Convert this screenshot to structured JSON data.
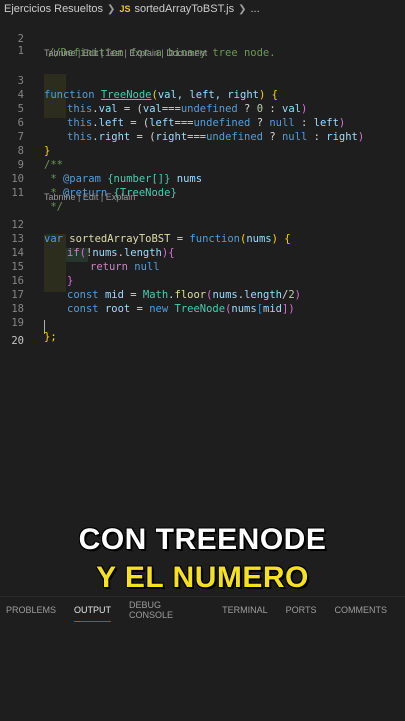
{
  "breadcrumb": {
    "folder": "Ejercicios Resueltos",
    "file_icon": "JS",
    "file": "sortedArrayToBST.js",
    "more": "..."
  },
  "codelens": {
    "lens1": "Tabnine | Edit | Test | Explain | Document",
    "lens2": "Tabnine | Edit | Explain"
  },
  "lines": [
    {
      "n": "1"
    },
    {
      "n": "2"
    },
    {
      "n": "3"
    },
    {
      "n": "4"
    },
    {
      "n": "5"
    },
    {
      "n": "6"
    },
    {
      "n": "7"
    },
    {
      "n": "8"
    },
    {
      "n": "9"
    },
    {
      "n": "10"
    },
    {
      "n": "11"
    },
    {
      "n": "12"
    },
    {
      "n": "13"
    },
    {
      "n": "14"
    },
    {
      "n": "15"
    },
    {
      "n": "16"
    },
    {
      "n": "17"
    },
    {
      "n": "18"
    },
    {
      "n": "19"
    },
    {
      "n": "20"
    }
  ],
  "code": {
    "l2": "//Definition for a binary tree node.",
    "l3": [
      "function",
      "TreeNode",
      "(",
      "val, left, right",
      ")",
      " {"
    ],
    "l4": [
      "this",
      ".",
      "val",
      " = (",
      "val",
      "===",
      "undefined",
      " ? ",
      "0",
      " : ",
      "val",
      ")"
    ],
    "l5": [
      "this",
      ".",
      "left",
      " = (",
      "left",
      "===",
      "undefined",
      " ? ",
      "null",
      " : ",
      "left",
      ")"
    ],
    "l6": [
      "this",
      ".",
      "right",
      " = (",
      "right",
      "===",
      "undefined",
      " ? ",
      "null",
      " : ",
      "right",
      ")"
    ],
    "l7": "}",
    "l8": "/**",
    "l9": [
      " * ",
      "@param",
      " {number[]} ",
      "nums"
    ],
    "l10": [
      " * ",
      "@return",
      " {TreeNode}"
    ],
    "l11": " */",
    "l12": [
      "var ",
      "sortedArrayToBST",
      " = ",
      "function",
      "(",
      "nums",
      ") {"
    ],
    "l13": [
      "if",
      "(",
      "!",
      "nums",
      ".",
      "length",
      "){"
    ],
    "l14": [
      "return ",
      "null"
    ],
    "l15": "}",
    "l16": [
      "const ",
      "mid",
      " = ",
      "Math",
      ".",
      "floor",
      "(",
      "nums",
      ".",
      "length",
      "/",
      "2",
      ")"
    ],
    "l17": [
      "const ",
      "root",
      " = ",
      "new ",
      "TreeNode",
      "(",
      "nums",
      "[",
      "mid",
      "])"
    ],
    "l19": "};"
  },
  "captions": {
    "line1": "CON TREENODE",
    "line2": "Y EL NUMERO"
  },
  "panel_tabs": [
    "PROBLEMS",
    "OUTPUT",
    "DEBUG CONSOLE",
    "TERMINAL",
    "PORTS",
    "COMMENTS"
  ],
  "active_panel_tab": "OUTPUT",
  "colors": {
    "editor_bg": "#1e1e1e",
    "keyword": "#569cd6",
    "caption_yellow": "#f5e11f",
    "accent": "#0078d4"
  }
}
